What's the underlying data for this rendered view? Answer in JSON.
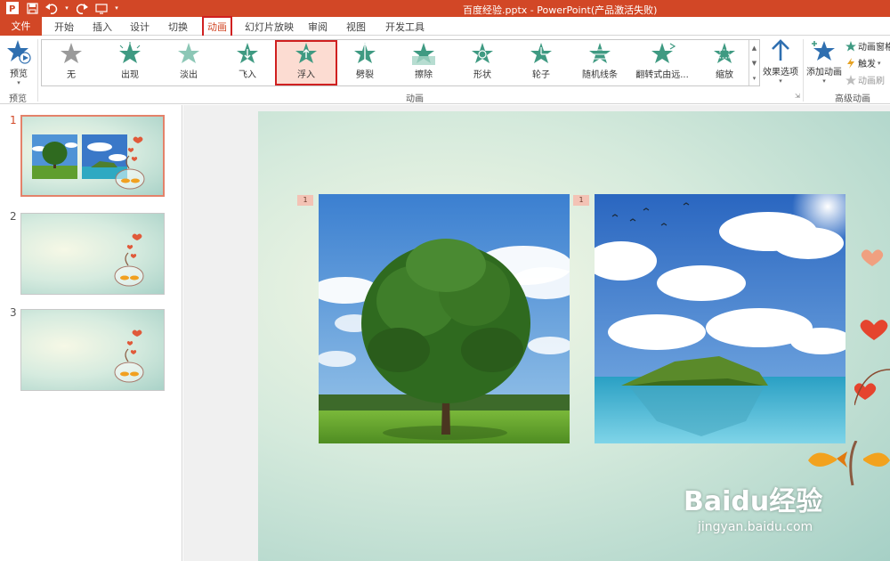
{
  "window": {
    "title": "百度经验.pptx - PowerPoint(产品激活失败)"
  },
  "tabs": {
    "file": "文件",
    "items": [
      "开始",
      "插入",
      "设计",
      "切换",
      "动画",
      "幻灯片放映",
      "审阅",
      "视图",
      "开发工具"
    ],
    "active": "动画"
  },
  "ribbon": {
    "preview": {
      "label": "预览",
      "group": "预览"
    },
    "animations": [
      "无",
      "出现",
      "淡出",
      "飞入",
      "浮入",
      "劈裂",
      "擦除",
      "形状",
      "轮子",
      "随机线条",
      "翻转式由远...",
      "缩放"
    ],
    "selected_animation": "浮入",
    "animation_group": "动画",
    "effect_options": "效果选项",
    "add_animation": "添加动画",
    "advanced": [
      "动画窗格",
      "触发",
      "动画刷"
    ],
    "advanced_group": "高级动画"
  },
  "slides": {
    "numbers": [
      "1",
      "2",
      "3"
    ],
    "active": "1"
  },
  "slide": {
    "tags": [
      "1",
      "1"
    ]
  },
  "watermark": {
    "main": "Baidu经验",
    "sub": "jingyan.baidu.com"
  },
  "colors": {
    "accent": "#d24726",
    "star": "#3f9a82",
    "highlight": "#d02020"
  }
}
